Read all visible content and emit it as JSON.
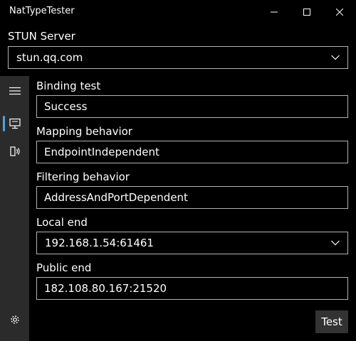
{
  "window": {
    "title": "NatTypeTester"
  },
  "stun": {
    "label": "STUN Server",
    "value": "stun.qq.com"
  },
  "fields": {
    "binding": {
      "label": "Binding test",
      "value": "Success"
    },
    "mapping": {
      "label": "Mapping behavior",
      "value": "EndpointIndependent"
    },
    "filtering": {
      "label": "Filtering behavior",
      "value": "AddressAndPortDependent"
    },
    "local": {
      "label": "Local end",
      "value": "192.168.1.54:61461"
    },
    "public": {
      "label": "Public end",
      "value": "182.108.80.167:21520"
    }
  },
  "actions": {
    "test_label": "Test"
  },
  "nav": {
    "items": [
      {
        "icon": "hamburger-menu-icon"
      },
      {
        "icon": "monitor-icon",
        "selected": true
      },
      {
        "icon": "speaker-waves-icon"
      },
      {
        "icon": "gear-icon"
      }
    ]
  },
  "colors": {
    "background": "#000000",
    "nav_pane": "#2b2b2b",
    "border": "#b3b3b3",
    "accent": "#4ca3e6",
    "button": "#333333"
  }
}
